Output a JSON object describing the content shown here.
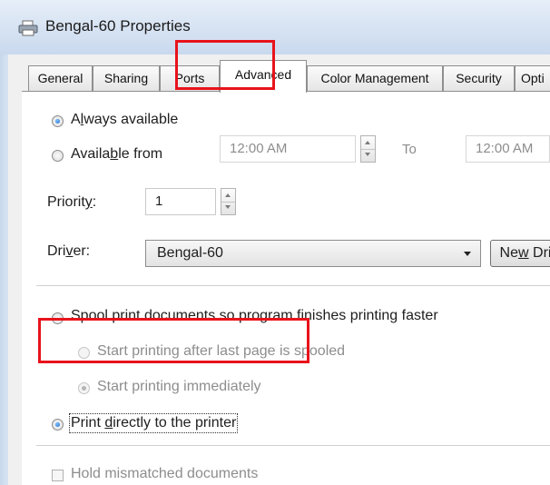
{
  "window": {
    "title": "Bengal-60 Properties"
  },
  "tabs": [
    {
      "label": "General",
      "active": false
    },
    {
      "label": "Sharing",
      "active": false
    },
    {
      "label": "Ports",
      "active": false
    },
    {
      "label": "Advanced",
      "active": true
    },
    {
      "label": "Color Management",
      "active": false
    },
    {
      "label": "Security",
      "active": false
    },
    {
      "label": "Opti",
      "active": false
    }
  ],
  "availability": {
    "always_label": "Always available",
    "always_mnemonic": "l",
    "from_label": "Available from",
    "from_mnemonic": "b",
    "selected": "always",
    "from_time": "12:00 AM",
    "to_label": "To",
    "to_time": "12:00 AM"
  },
  "priority": {
    "label": "Priority:",
    "value": "1"
  },
  "driver": {
    "label": "Driver:",
    "value": "Bengal-60",
    "new_button": "New"
  },
  "spooling": {
    "spool_label": "Spool print documents so program finishes printing faster",
    "after_last_page_label": "Start printing after last page is spooled",
    "immediately_label": "Start printing immediately",
    "direct_label": "Print directly to the printer",
    "selected": "direct"
  },
  "hold_mismatched": {
    "label": "Hold mismatched documents",
    "checked": false
  },
  "annotation_color": "#e8131b",
  "accent_color": "#1b66c9"
}
